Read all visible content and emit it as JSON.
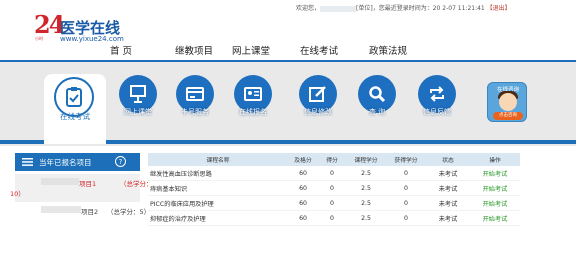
{
  "header": {
    "welcome_prefix": "欢迎您，",
    "welcome_suffix": "[单位]，您最近登录时间为：20",
    "login_time": "2-07 11:21:41",
    "logout": "【退出】"
  },
  "logo": {
    "number": "24",
    "sub": "小时",
    "title": "医学在线",
    "url": "www.yixue24.com"
  },
  "nav": [
    "首 页",
    "继教项目",
    "网上课堂",
    "在线考试",
    "政策法规"
  ],
  "tabs": {
    "active": "在线考试",
    "items": [
      "网上课堂",
      "卡号服务",
      "在线报名",
      "信息修改",
      "查 询",
      "信息反馈"
    ]
  },
  "consult": {
    "title": "在线咨询",
    "button": "点击咨询"
  },
  "sidebar": {
    "title": "当年已报名项目",
    "help": "?",
    "projects": [
      {
        "name": "项目1",
        "credit_a": "（总学分：",
        "credit_b": "10）"
      },
      {
        "name": "项目2",
        "credit": "（总学分：5）"
      }
    ]
  },
  "table": {
    "headers": [
      "课程名称",
      "及格分",
      "得分",
      "课程学分",
      "获得学分",
      "状态",
      "操作"
    ],
    "rows": [
      [
        "继发性高血压诊断思路",
        "60",
        "0",
        "2.5",
        "0",
        "未考试",
        "开始考试"
      ],
      [
        "痔病基本知识",
        "60",
        "0",
        "2.5",
        "0",
        "未考试",
        "开始考试"
      ],
      [
        "PICC的临床应用及护理",
        "60",
        "0",
        "2.5",
        "0",
        "未考试",
        "开始考试"
      ],
      [
        "抑郁症的治疗及护理",
        "60",
        "0",
        "2.5",
        "0",
        "未考试",
        "开始考试"
      ]
    ]
  },
  "colors": {
    "primary": "#1c6fb8",
    "accent_red": "#d0252a",
    "action_green": "#2a9a2a"
  }
}
